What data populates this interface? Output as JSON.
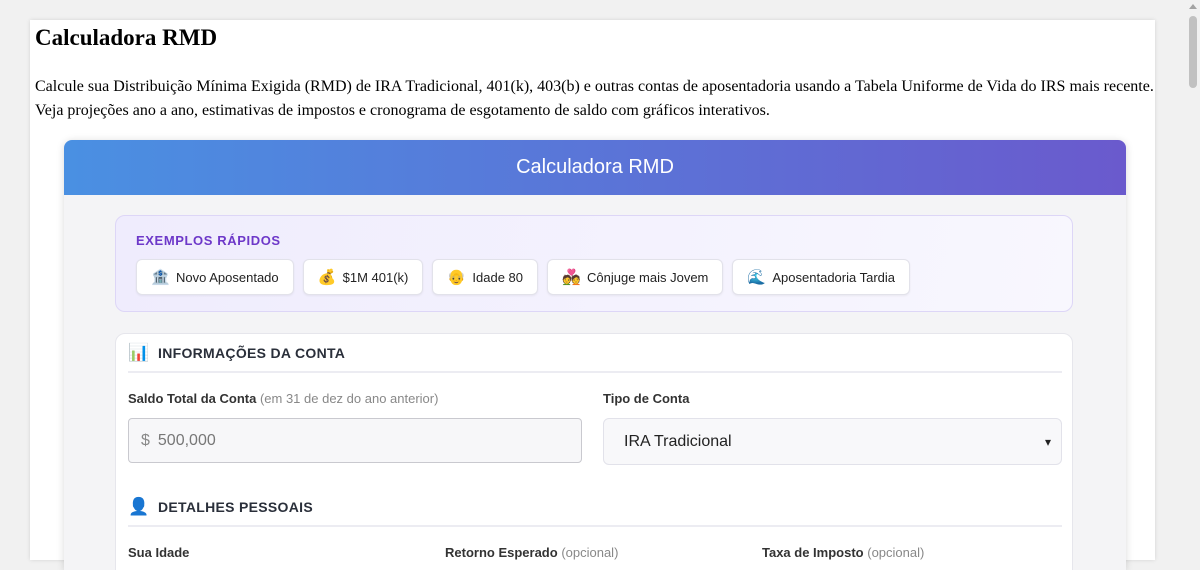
{
  "page": {
    "title": "Calculadora RMD",
    "description": "Calcule sua Distribuição Mínima Exigida (RMD) de IRA Tradicional, 401(k), 403(b) e outras contas de aposentadoria usando a Tabela Uniforme de Vida do IRS mais recente. Veja projeções ano a ano, estimativas de impostos e cronograma de esgotamento de saldo com gráficos interativos."
  },
  "app": {
    "header": "Calculadora RMD",
    "header_gradient": [
      "#4a90e2",
      "#6a5acd"
    ]
  },
  "examples": {
    "title": "EXEMPLOS RÁPIDOS",
    "items": [
      {
        "icon": "🏦",
        "icon_name": "bank-icon",
        "label": "Novo Aposentado"
      },
      {
        "icon": "💰",
        "icon_name": "money-bag-icon",
        "label": "$1M 401(k)"
      },
      {
        "icon": "👴",
        "icon_name": "older-man-icon",
        "label": "Idade 80"
      },
      {
        "icon": "💑",
        "icon_name": "couple-icon",
        "label": "Cônjuge mais Jovem"
      },
      {
        "icon": "🌊",
        "icon_name": "wave-icon",
        "label": "Aposentadoria Tardia"
      }
    ]
  },
  "account_section": {
    "icon": "📊",
    "title": "INFORMAÇÕES DA CONTA",
    "balance_label": "Saldo Total da Conta",
    "balance_hint": "(em 31 de dez do ano anterior)",
    "balance_prefix": "$",
    "balance_placeholder": "500,000",
    "type_label": "Tipo de Conta",
    "type_value": "IRA Tradicional"
  },
  "personal_section": {
    "icon": "👤",
    "title": "DETALHES PESSOAIS",
    "age_label": "Sua Idade",
    "return_label": "Retorno Esperado",
    "return_hint": "(opcional)",
    "tax_label": "Taxa de Imposto",
    "tax_hint": "(opcional)"
  }
}
